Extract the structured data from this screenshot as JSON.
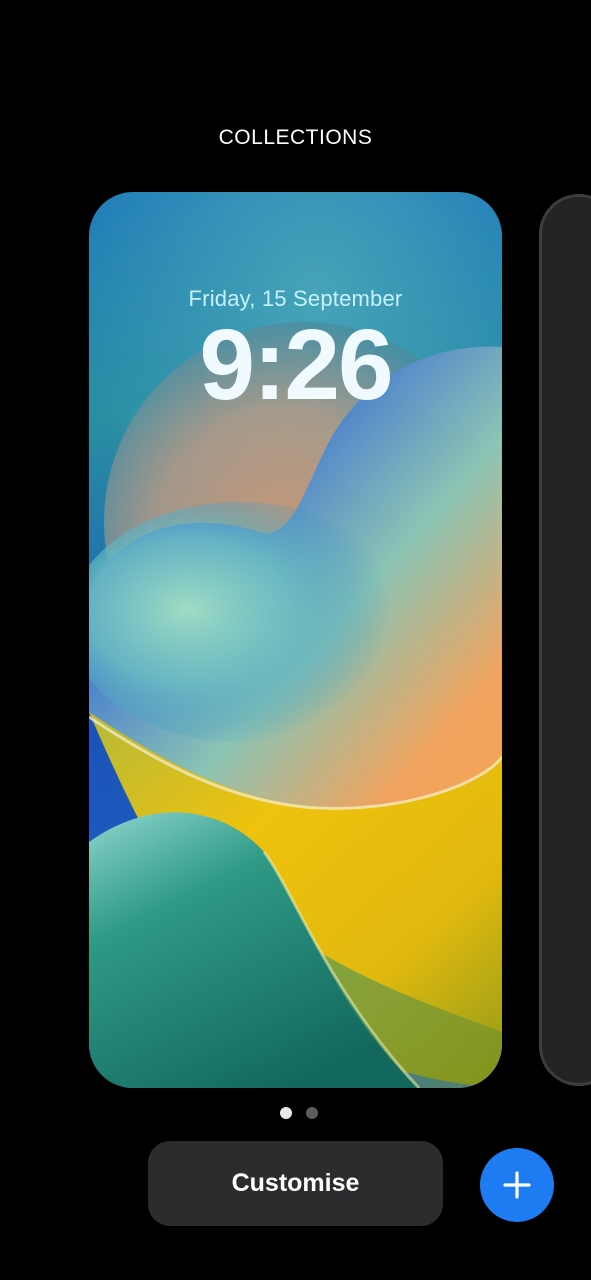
{
  "header": {
    "title": "COLLECTIONS"
  },
  "lock_screen": {
    "date": "Friday, 15 September",
    "time": "9:26"
  },
  "pager": {
    "page_count": 2,
    "active_index": 0
  },
  "actions": {
    "customise_label": "Customise",
    "add_icon": "plus-icon"
  },
  "colors": {
    "background": "#000000",
    "button_fill": "#2c2c2e",
    "add_button": "#1e7cf2",
    "wallpaper_blue": "#1d4fc4",
    "wallpaper_orange": "#f2a35c",
    "wallpaper_yellow": "#eec20e",
    "wallpaper_teal": "#1f7c73"
  }
}
